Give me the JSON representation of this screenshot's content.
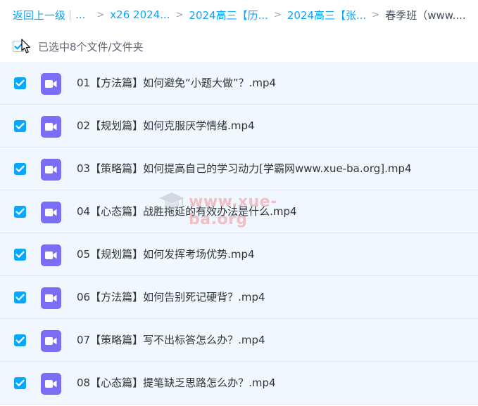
{
  "breadcrumb": {
    "back_label": "返回上一级",
    "separator_bar": "|",
    "ellipsis": "...",
    "crumbs": [
      "x26 2024...",
      "2024高三【历...",
      "2024高三【张..."
    ],
    "current": "春季班（www...."
  },
  "selection": {
    "summary": "已选中8个文件/文件夹"
  },
  "files": [
    {
      "name": "01【方法篇】如何避免“小题大做”？.mp4"
    },
    {
      "name": "02【规划篇】如何克服厌学情绪.mp4"
    },
    {
      "name": "03【策略篇】如何提高自己的学习动力[学霸网www.xue-ba.org].mp4"
    },
    {
      "name": "04【心态篇】战胜拖延的有效办法是什么.mp4"
    },
    {
      "name": "05【规划篇】如何发挥考场优势.mp4"
    },
    {
      "name": "06【方法篇】如何告别死记硬背？.mp4"
    },
    {
      "name": "07【策略篇】写不出标答怎么办？.mp4"
    },
    {
      "name": "08【心态篇】提笔缺乏思路怎么办？.mp4"
    }
  ],
  "watermark": {
    "text": "www.xue-ba.org"
  },
  "colors": {
    "accent": "#06a7ff",
    "row_selected_bg": "#f1f7fe",
    "video_icon": "#7a6ef5"
  },
  "icons": {
    "checkbox": "check-icon",
    "file": "video-file-icon",
    "pointer": "mouse-cursor-icon"
  }
}
